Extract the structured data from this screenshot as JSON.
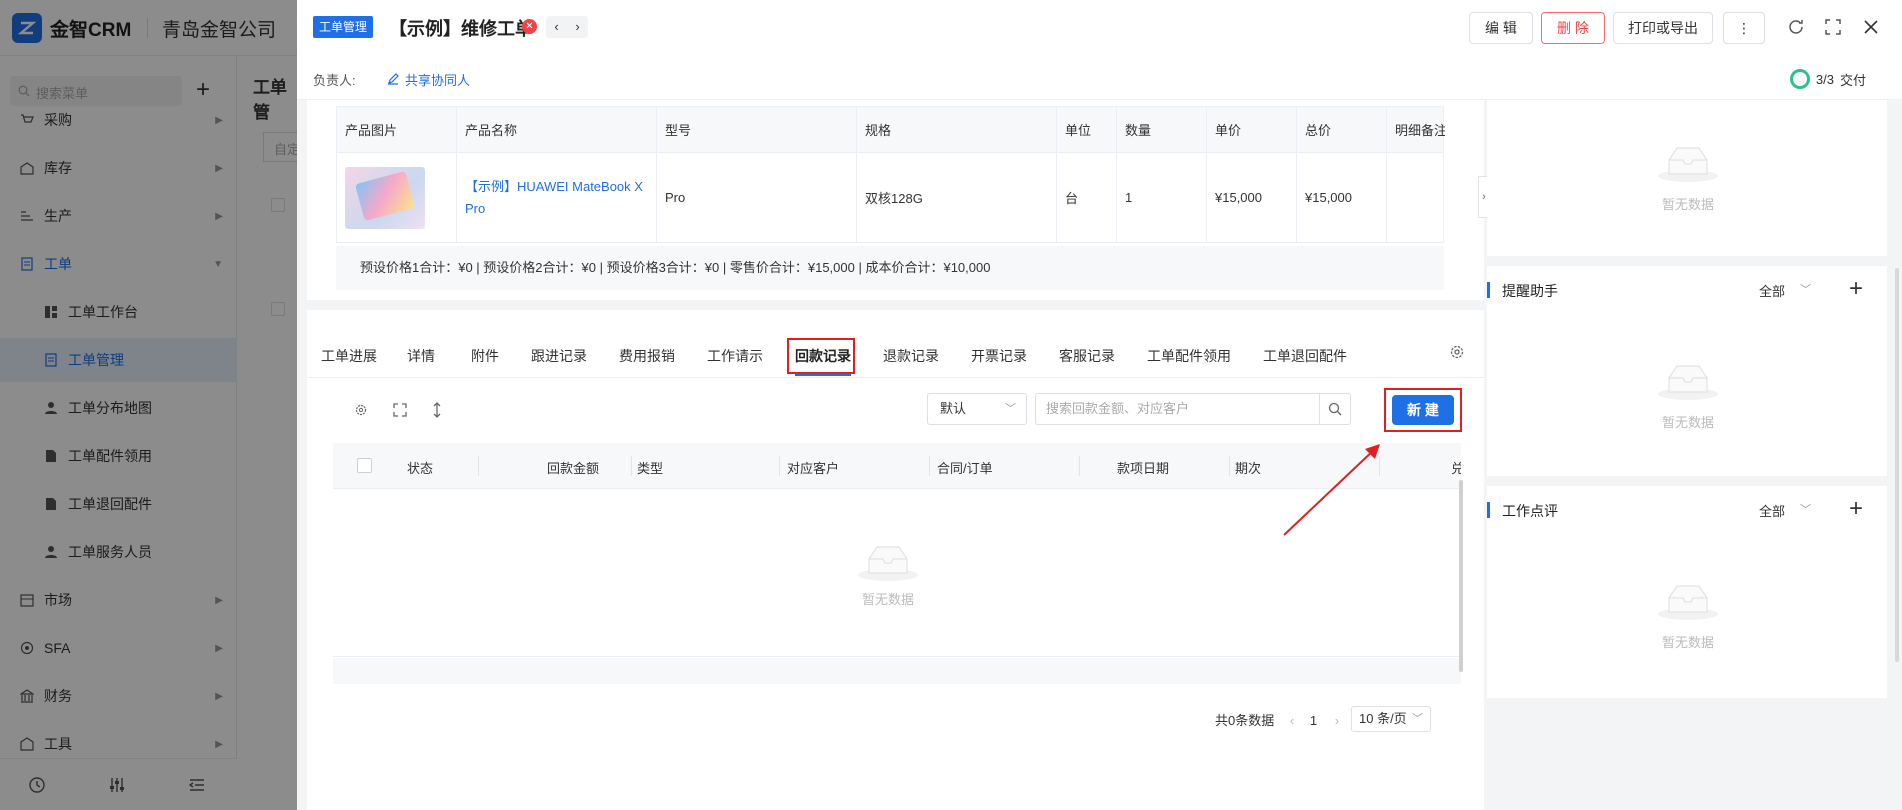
{
  "app": {
    "brand": "金智CRM",
    "company": "青岛金智公司",
    "menu_search_placeholder": "搜索菜单",
    "add_icon": "+",
    "behind_title": "工单管",
    "behind_input": "自定"
  },
  "sidebar": {
    "items": [
      {
        "label": "采购",
        "icon": "cart-icon"
      },
      {
        "label": "库存",
        "icon": "warehouse-icon"
      },
      {
        "label": "生产",
        "icon": "production-icon"
      },
      {
        "label": "工单",
        "icon": "document-icon"
      },
      {
        "label": "工单工作台",
        "icon": "dashboard-icon"
      },
      {
        "label": "工单管理",
        "icon": "document-icon"
      },
      {
        "label": "工单分布地图",
        "icon": "person-icon"
      },
      {
        "label": "工单配件领用",
        "icon": "file-icon"
      },
      {
        "label": "工单退回配件",
        "icon": "file-icon"
      },
      {
        "label": "工单服务人员",
        "icon": "person-icon"
      },
      {
        "label": "市场",
        "icon": "calendar-icon"
      },
      {
        "label": "SFA",
        "icon": "sfa-icon"
      },
      {
        "label": "财务",
        "icon": "bank-icon"
      },
      {
        "label": "工具",
        "icon": "tool-icon"
      }
    ],
    "active": "工单管理"
  },
  "drawer": {
    "tag": "工单管理",
    "title": "【示例】维修工单",
    "actions": {
      "edit": "编 辑",
      "delete": "删 除",
      "print": "打印或导出",
      "more": "⋮"
    },
    "owner_label": "负责人:",
    "share_link": "共享协同人",
    "progress": {
      "text": "3/3",
      "stage": "交付"
    }
  },
  "product_table": {
    "columns": [
      "产品图片",
      "产品名称",
      "型号",
      "规格",
      "单位",
      "数量",
      "单价",
      "总价",
      "明细备注"
    ],
    "rows": [
      {
        "name": "【示例】HUAWEI MateBook X Pro",
        "model": "Pro",
        "spec": "双核128G",
        "unit": "台",
        "qty": "1",
        "price": "¥15,000",
        "total": "¥15,000",
        "note": ""
      }
    ],
    "summary": "预设价格1合计：¥0 |   预设价格2合计：¥0 |   预设价格3合计：¥0 |   零售价合计：¥15,000 |   成本价合计：¥10,000"
  },
  "tabs": {
    "items": [
      "工单进展",
      "详情",
      "附件",
      "跟进记录",
      "费用报销",
      "工作请示",
      "回款记录",
      "退款记录",
      "开票记录",
      "客服记录",
      "工单配件领用",
      "工单退回配件"
    ],
    "active": "回款记录"
  },
  "records": {
    "filter_default": "默认",
    "search_placeholder": "搜索回款金额、对应客户",
    "new_button": "新 建",
    "columns": [
      "状态",
      "回款金额",
      "类型",
      "对应客户",
      "合同/订单",
      "款项日期",
      "期次",
      "兑"
    ],
    "empty_text": "暂无数据",
    "pagination": {
      "total": "共0条数据",
      "page": "1",
      "page_size": "10 条/页"
    }
  },
  "right_panel": {
    "empty_text": "暂无数据",
    "reminder": {
      "title": "提醒助手",
      "filter": "全部"
    },
    "review": {
      "title": "工作点评",
      "filter": "全部"
    }
  },
  "colors": {
    "accent": "#1f6fe5",
    "danger": "#f04343",
    "success": "#2bc28c",
    "highlight": "#e02020"
  }
}
